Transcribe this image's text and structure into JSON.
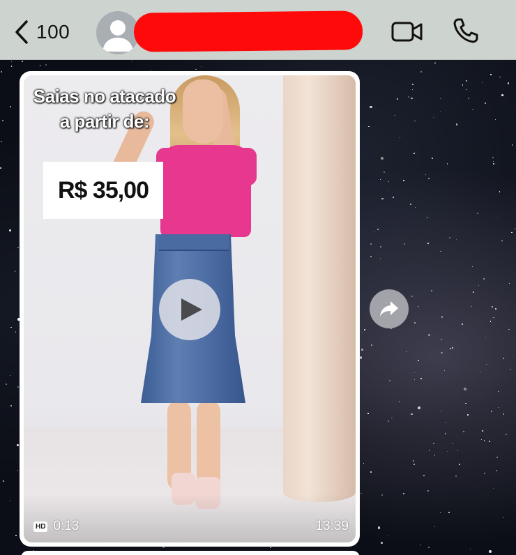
{
  "header": {
    "back_count": "100",
    "contact_name": "",
    "colors": {
      "bar": "#cdd3cf",
      "redaction": "#ff0a0a"
    },
    "icons": [
      "chevron-left-icon",
      "avatar-placeholder-icon",
      "video-call-icon",
      "phone-call-icon"
    ]
  },
  "message": {
    "headline_line1": "Saias no atacado",
    "headline_line2": "a partir de:",
    "price": "R$ 35,00",
    "quality_badge": "HD",
    "duration": "0:13",
    "timestamp": "13:39",
    "icons": [
      "play-icon",
      "forward-icon"
    ]
  }
}
